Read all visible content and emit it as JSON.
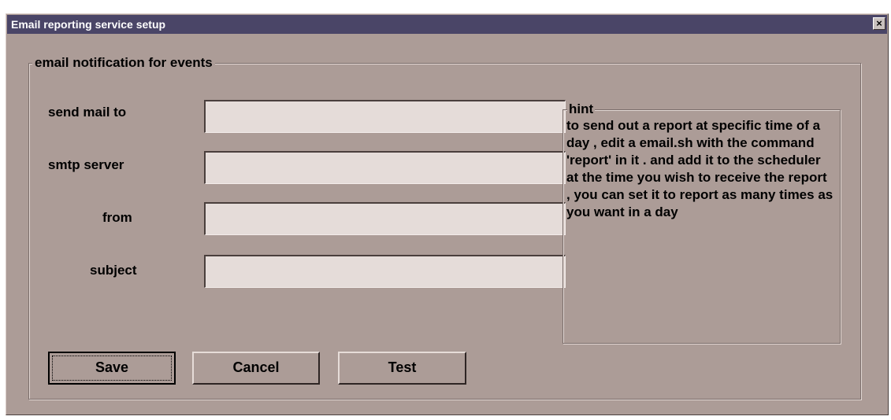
{
  "window": {
    "title": "Email reporting service setup",
    "close_label": "×"
  },
  "group": {
    "legend": "email notification for events"
  },
  "fields": {
    "send_mail_to": {
      "label": "send mail to",
      "value": ""
    },
    "smtp_server": {
      "label": "smtp server",
      "value": ""
    },
    "from": {
      "label": "from",
      "value": ""
    },
    "subject": {
      "label": "subject",
      "value": ""
    }
  },
  "buttons": {
    "save": "Save",
    "cancel": "Cancel",
    "test": "Test"
  },
  "hint": {
    "legend": "hint",
    "text": "to send out a report at specific time of a day , edit a email.sh with the command 'report' in it . and add it to the scheduler at the time you wish to receive the report , you can set it to report as many times as you want in a day"
  },
  "colors": {
    "titlebar": "#4a4567",
    "background": "#ac9c97",
    "field": "#e5dcd9"
  }
}
